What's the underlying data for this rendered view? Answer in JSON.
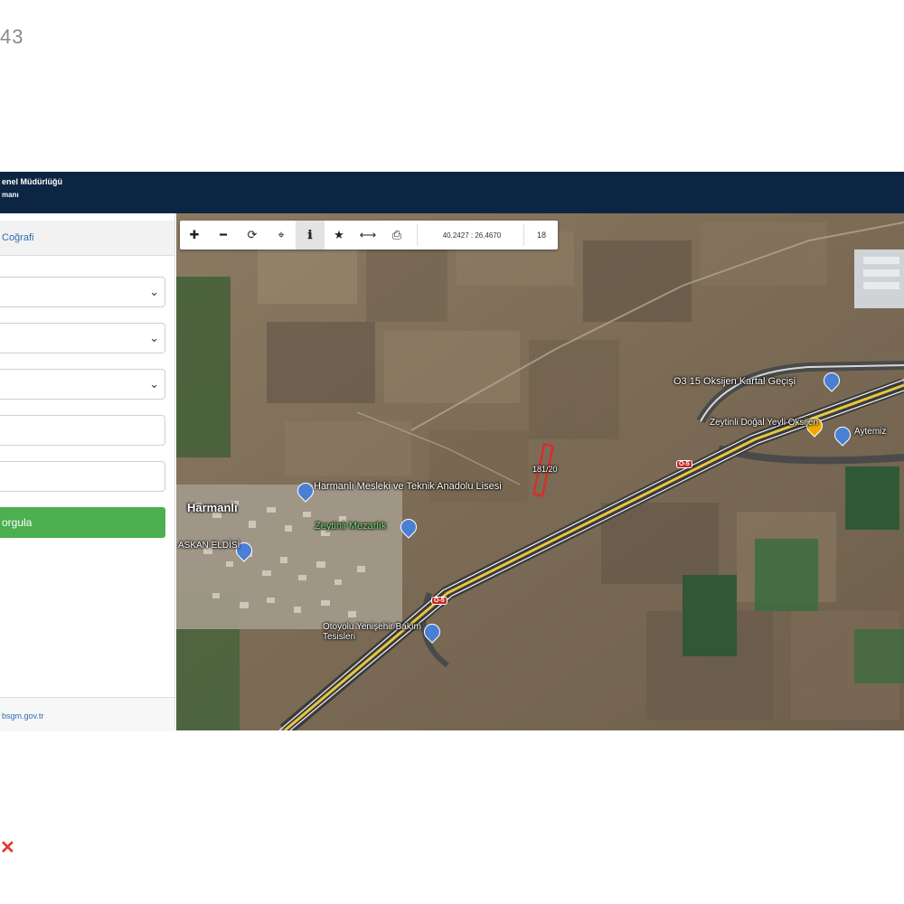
{
  "corner_number": "43",
  "header": {
    "title": "enel Müdürlüğü",
    "subtitle": "manı"
  },
  "sidebar": {
    "tab_label": "Coğrafi",
    "query_button": "orgula",
    "footer_link": "bsgm.gov.tr"
  },
  "map_toolbar": {
    "coordinates": "40.2427 : 26.4670",
    "zoom": "18"
  },
  "map_labels": {
    "town": "Harmanlı",
    "school": "Harmanlı Mesleki ve Teknik Anadolu Lisesi",
    "service": "Zeytinli Mezarlık",
    "shop": "ASKAN ELDİSİ",
    "gas": "O3 15 Oksijen Kartal Geçişi",
    "station": "Zeytinli Doğal Yeyli Oksijen",
    "station2": "Aytemiz",
    "maintenance": "Otoyolu Yenişehir Bakım Tesisleri",
    "parcel": "181/20",
    "road_shield_1": "O-5",
    "road_shield_2": "O-5"
  },
  "colors": {
    "header_bg": "#0b2542",
    "query_button_bg": "#4caf50",
    "parcel_outline": "#d32f2f"
  }
}
